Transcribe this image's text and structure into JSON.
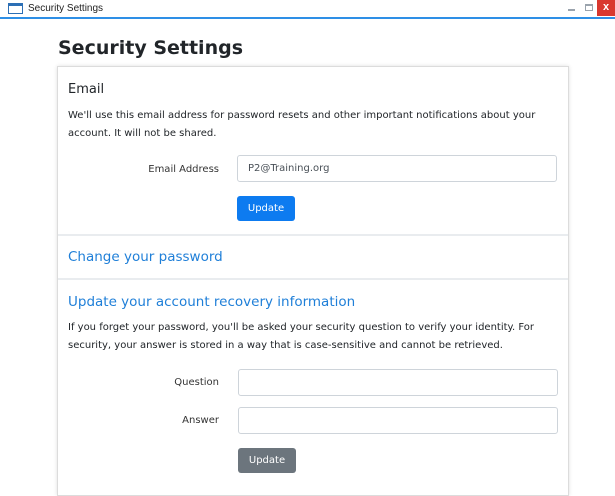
{
  "window": {
    "title": "Security Settings",
    "close_glyph": "x"
  },
  "page": {
    "title": "Security Settings"
  },
  "email_section": {
    "heading": "Email",
    "description": "We'll use this email address for password resets and other important notifications about your account. It will not be shared.",
    "email_label": "Email Address",
    "email_value": "P2@Training.org",
    "update_label": "Update"
  },
  "password_section": {
    "link_text": "Change your password"
  },
  "recovery_section": {
    "heading": "Update your account recovery information",
    "description": "If you forget your password, you'll be asked your security question to verify your identity. For security, your answer is stored in a way that is case-sensitive and cannot be retrieved.",
    "question_label": "Question",
    "question_value": "",
    "answer_label": "Answer",
    "answer_value": "",
    "update_label": "Update"
  },
  "colors": {
    "primary": "#0d7bf0",
    "secondary": "#6c757d",
    "link": "#1f7fd8",
    "close": "#d9382f"
  },
  "icons": {
    "app": "window-icon",
    "minimize": "minimize-icon",
    "maximize": "maximize-icon",
    "close": "close-icon"
  }
}
